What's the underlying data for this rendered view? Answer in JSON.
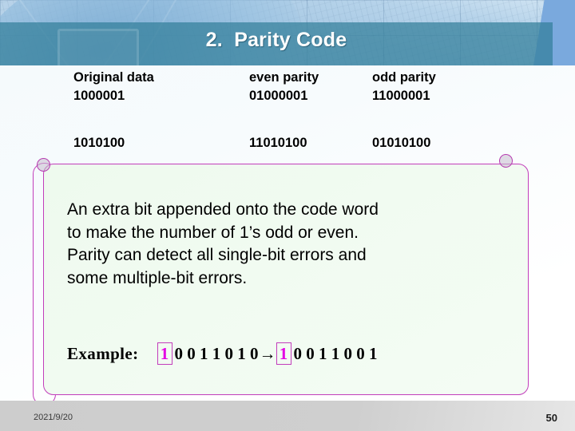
{
  "header": {
    "title": "2.  Parity Code"
  },
  "table": {
    "columns": [
      "Original data",
      "even parity",
      "odd parity"
    ],
    "rows": [
      [
        "1000001",
        "01000001",
        "11000001"
      ],
      [
        "1010100",
        "11010100",
        "01010100"
      ]
    ]
  },
  "body": {
    "paragraph": "An extra bit appended onto the code word\nto make the number of 1’s odd or even.\nParity can detect all single-bit errors and\nsome multiple-bit errors."
  },
  "example": {
    "label": "Example:",
    "left_parity_bit": "1",
    "left_bits": "0 0 1 1 0 1 0",
    "arrow": "→",
    "right_parity_bit": "1",
    "right_bits": "0 0 1 1 0 0 1"
  },
  "footer": {
    "date": "2021/9/20",
    "page_number": "50"
  },
  "colors": {
    "accent_magenta": "#c23dbb",
    "bit_magenta": "#e300e3",
    "header_teal": "#307e98",
    "panel_mint": "#eefaee",
    "right_blue": "#7aa9dd"
  }
}
